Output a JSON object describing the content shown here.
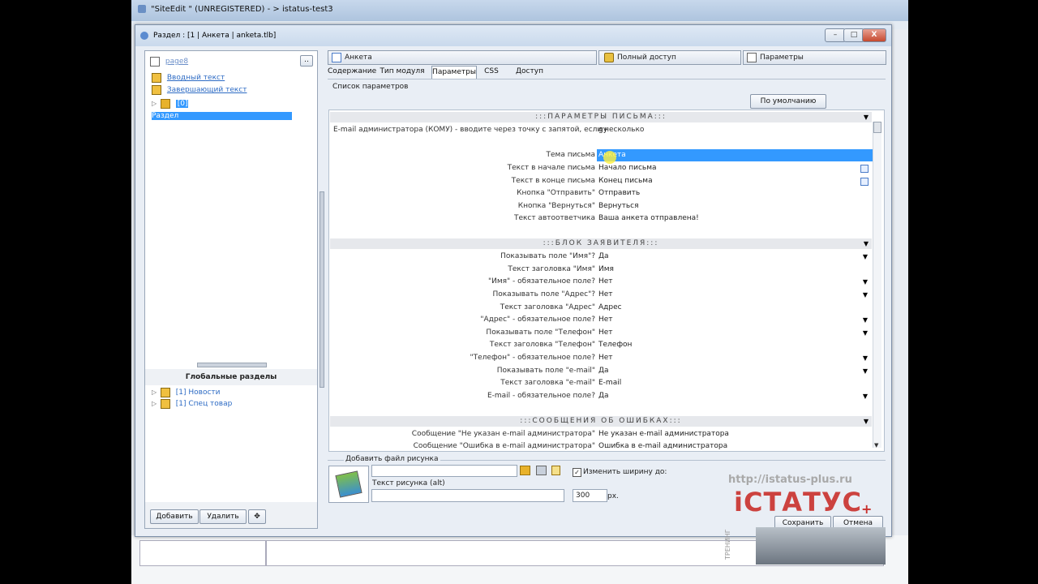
{
  "outer_window": {
    "title": "\"SiteEdit \" (UNREGISTERED) - > istatus-test3"
  },
  "dialog": {
    "title": "Раздел : [1 | Анкета | anketa.tlb]",
    "buttons": {
      "minimize": "–",
      "maximize": "□",
      "close": "X"
    }
  },
  "left_panel": {
    "page_link": "page8",
    "browse_button": "..",
    "tree": [
      {
        "label": "Вводный текст"
      },
      {
        "label": "Завершающий текст"
      },
      {
        "label": "[0] Раздел"
      }
    ],
    "global_title": "Глобальные разделы",
    "global_items": [
      {
        "label": "[1] Новости"
      },
      {
        "label": "[1] Спец товар"
      }
    ],
    "add_button": "Добавить",
    "delete_button": "Удалить"
  },
  "top_tabs": {
    "anketa": "Анкета",
    "access": "Полный доступ",
    "params": "Параметры"
  },
  "sub_tabs": [
    "Содержание",
    "Тип модуля",
    "Параметры",
    "CSS",
    "Доступ"
  ],
  "params_list_label": "Список параметров",
  "default_button": "По умолчанию",
  "sections": [
    {
      "title": ":::ПАРАМЕТРЫ ПИСЬМА:::",
      "rows": [
        {
          "label": "E-mail администратора (КОМУ) - вводите через точку с запятой, если несколько",
          "value": "gy"
        },
        {
          "label": "Тема письма",
          "value": "Анкета"
        },
        {
          "label": "Текст в начале письма",
          "value": "Начало письма"
        },
        {
          "label": "Текст в конце письма",
          "value": "Конец письма"
        },
        {
          "label": "Кнопка \"Отправить\"",
          "value": "Отправить"
        },
        {
          "label": "Кнопка \"Вернуться\"",
          "value": "Вернуться"
        },
        {
          "label": "Текст автоответчика",
          "value": "Ваша анкета отправлена!"
        }
      ]
    },
    {
      "title": ":::БЛОК ЗАЯВИТЕЛЯ:::",
      "rows": [
        {
          "label": "Показывать поле \"Имя\"?",
          "value": "Да"
        },
        {
          "label": "Текст заголовка \"Имя\"",
          "value": "Имя"
        },
        {
          "label": "\"Имя\" - обязательное поле?",
          "value": "Нет"
        },
        {
          "label": "Показывать поле \"Адрес\"?",
          "value": "Нет"
        },
        {
          "label": "Текст заголовка \"Адрес\"",
          "value": "Адрес"
        },
        {
          "label": "\"Адрес\" - обязательное поле?",
          "value": "Нет"
        },
        {
          "label": "Показывать поле \"Телефон\"",
          "value": "Нет"
        },
        {
          "label": "Текст заголовка \"Телефон\"",
          "value": "Телефон"
        },
        {
          "label": "\"Телефон\" - обязательное поле?",
          "value": "Нет"
        },
        {
          "label": "Показывать поле \"e-mail\"",
          "value": "Да"
        },
        {
          "label": "Текст заголовка \"e-mail\"",
          "value": "E-mail"
        },
        {
          "label": "E-mail - обязательное поле?",
          "value": "Да"
        }
      ]
    },
    {
      "title": ":::СООБЩЕНИЯ ОБ ОШИБКАХ:::",
      "rows": [
        {
          "label": "Сообщение \"Не указан e-mail администратора\"",
          "value": "Не указан e-mail администратора"
        },
        {
          "label": "Сообщение \"Ошибка в e-mail администратора\"",
          "value": "Ошибка в e-mail администратора"
        }
      ]
    }
  ],
  "picture": {
    "group_label": "Добавить файл рисунка",
    "alt_label": "Текст рисунка (alt)",
    "resize_label": "Изменить ширину до:",
    "width_value": "300",
    "unit": "px."
  },
  "footer": {
    "save": "Сохранить",
    "cancel": "Отмена"
  },
  "watermark": {
    "url": "http://istatus-plus.ru",
    "logo": "iСТАТУС",
    "plus": "+",
    "sub": "ТРЕНИНГ"
  }
}
